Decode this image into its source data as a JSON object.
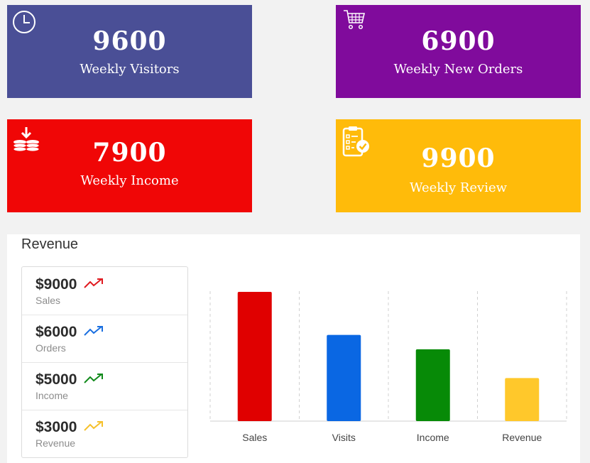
{
  "cards": [
    {
      "value": "9600",
      "label": "Weekly Visitors",
      "color": "#4a4f96",
      "icon": "clock-icon"
    },
    {
      "value": "6900",
      "label": "Weekly New Orders",
      "color": "#800b9c",
      "icon": "cart-icon"
    },
    {
      "value": "7900",
      "label": "Weekly Income",
      "color": "#f00606",
      "icon": "coins-icon"
    },
    {
      "value": "9900",
      "label": "Weekly Review",
      "color": "#ffbb0a",
      "icon": "clipboard-check-icon"
    }
  ],
  "revenue": {
    "title": "Revenue",
    "stats": [
      {
        "amount": "$9000",
        "label": "Sales",
        "trend_color": "#e0191f",
        "icon": "trend-up-icon"
      },
      {
        "amount": "$6000",
        "label": "Orders",
        "trend_color": "#1a6fe0",
        "icon": "trend-up-icon"
      },
      {
        "amount": "$5000",
        "label": "Income",
        "trend_color": "#118a1b",
        "icon": "trend-up-icon"
      },
      {
        "amount": "$3000",
        "label": "Revenue",
        "trend_color": "#f6c12c",
        "icon": "trend-up-icon"
      }
    ]
  },
  "chart_data": {
    "type": "bar",
    "categories": [
      "Sales",
      "Visits",
      "Income",
      "Revenue"
    ],
    "values": [
      9000,
      6000,
      5000,
      3000
    ],
    "colors": [
      "#e00000",
      "#0a67e3",
      "#078a07",
      "#ffc82b"
    ],
    "grid": "vertical-dashed"
  }
}
